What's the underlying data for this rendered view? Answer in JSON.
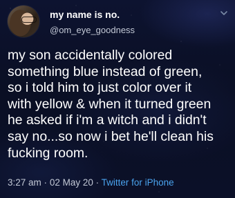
{
  "author": {
    "display_name": "my name is no.",
    "handle": "@om_eye_goodness"
  },
  "tweet": {
    "text": "my son accidentally colored\nsomething blue instead of green,\nso i told him to just color over it\nwith yellow & when it turned green\nhe asked if i'm a witch and i didn't\nsay no...so now i bet he'll clean his\nfucking room."
  },
  "meta": {
    "time": "3:27 am",
    "date": "02 May 20",
    "separator": "·",
    "source": "Twitter for iPhone"
  },
  "icons": {
    "menu": "chevron-down-icon"
  },
  "colors": {
    "link": "#4aa3ee",
    "secondary_text": "#c3c9d6",
    "primary_text": "#ffffff"
  }
}
